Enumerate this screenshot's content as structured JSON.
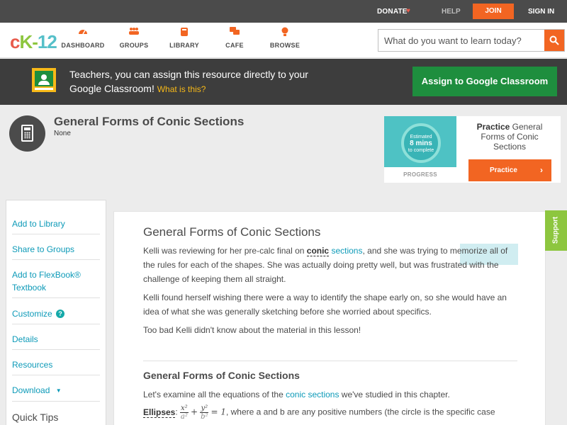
{
  "topbar": {
    "donate": "DONATE",
    "help": "HELP",
    "join": "JOIN",
    "signin": "SIGN IN"
  },
  "nav": {
    "logo_c": "c",
    "logo_k": "K",
    "logo_dash": "-",
    "logo_num": "12",
    "items": [
      {
        "label": "DASHBOARD",
        "icon": "dashboard-icon"
      },
      {
        "label": "GROUPS",
        "icon": "groups-icon"
      },
      {
        "label": "LIBRARY",
        "icon": "library-icon"
      },
      {
        "label": "CAFE",
        "icon": "cafe-icon"
      },
      {
        "label": "BROWSE",
        "icon": "browse-icon"
      }
    ],
    "search_placeholder": "What do you want to learn today?"
  },
  "banner": {
    "message": "Teachers, you can assign this resource directly to your Google Classroom!",
    "what": "What is this?",
    "assign": "Assign to Google Classroom"
  },
  "header": {
    "title": "General Forms of Conic Sections",
    "subtitle": "None"
  },
  "practice": {
    "estimated": "Estimated",
    "mins": "8 mins",
    "to_complete": "to complete",
    "progress": "PROGRESS",
    "title_bold": "Practice",
    "title_rest": "General Forms of Conic Sections",
    "button": "Practice"
  },
  "sidebar": {
    "items": [
      {
        "label": "Add to Library"
      },
      {
        "label": "Share to Groups"
      },
      {
        "label": "Add to FlexBook®",
        "label2": "Textbook"
      },
      {
        "label": "Customize"
      },
      {
        "label": "Details"
      },
      {
        "label": "Resources"
      },
      {
        "label": "Download"
      }
    ],
    "quick_tips": "Quick Tips"
  },
  "content": {
    "title": "General Forms of Conic Sections",
    "p1_a": "Kelli was reviewing for her pre-calc final on ",
    "p1_kw1": "conic",
    "p1_kw2": "sections",
    "p1_b": ", and she was trying to memorize all of the rules for each of the shapes. She was actually doing pretty well, but was frustrated with the challenge of keeping them all straight.",
    "p2": "Kelli found herself wishing there were a way to identify the shape early on, so she would have an idea of what she was generally sketching before she worried about specifics.",
    "p3": "Too bad Kelli didn't know about the material in this lesson!",
    "section": "General Forms of Conic Sections",
    "p4_a": "Let's examine all the equations of the ",
    "p4_kw": "conic sections",
    "p4_b": " we've studied in this chapter.",
    "ellipses_label": "Ellipses",
    "ellipses_rest": ", where a and b are any positive numbers (the circle is the specific case"
  },
  "support": "Support"
}
